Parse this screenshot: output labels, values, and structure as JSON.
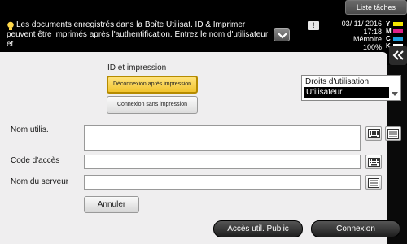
{
  "header": {
    "task_list_label": "Liste tâches"
  },
  "message": {
    "text": "Les documents enregistrés dans la Boîte Utilisat. ID & Imprimer peuvent être imprimés après l'authentification. Entrez le nom d'utilisateur et",
    "date": "03/ 11/ 2016",
    "time": "17:18",
    "memory_label": "Mémoire",
    "memory_value": "100%"
  },
  "toner": [
    {
      "label": "Y",
      "color": "#f4e400"
    },
    {
      "label": "M",
      "color": "#e0208a"
    },
    {
      "label": "C",
      "color": "#1fa0e0"
    },
    {
      "label": "K",
      "color": "#ffffff"
    }
  ],
  "auth": {
    "section_title": "ID et impression",
    "logout_after_print": "Déconnexion après impression",
    "login_without_print": "Connexion sans impression",
    "rights_label": "Droits d'utilisation",
    "rights_value": "Utilisateur"
  },
  "fields": {
    "username_label": "Nom utilis.",
    "password_label": "Code d'accès",
    "server_label": "Nom du serveur"
  },
  "buttons": {
    "cancel": "Annuler",
    "public_access": "Accès util. Public",
    "login": "Connexion"
  }
}
